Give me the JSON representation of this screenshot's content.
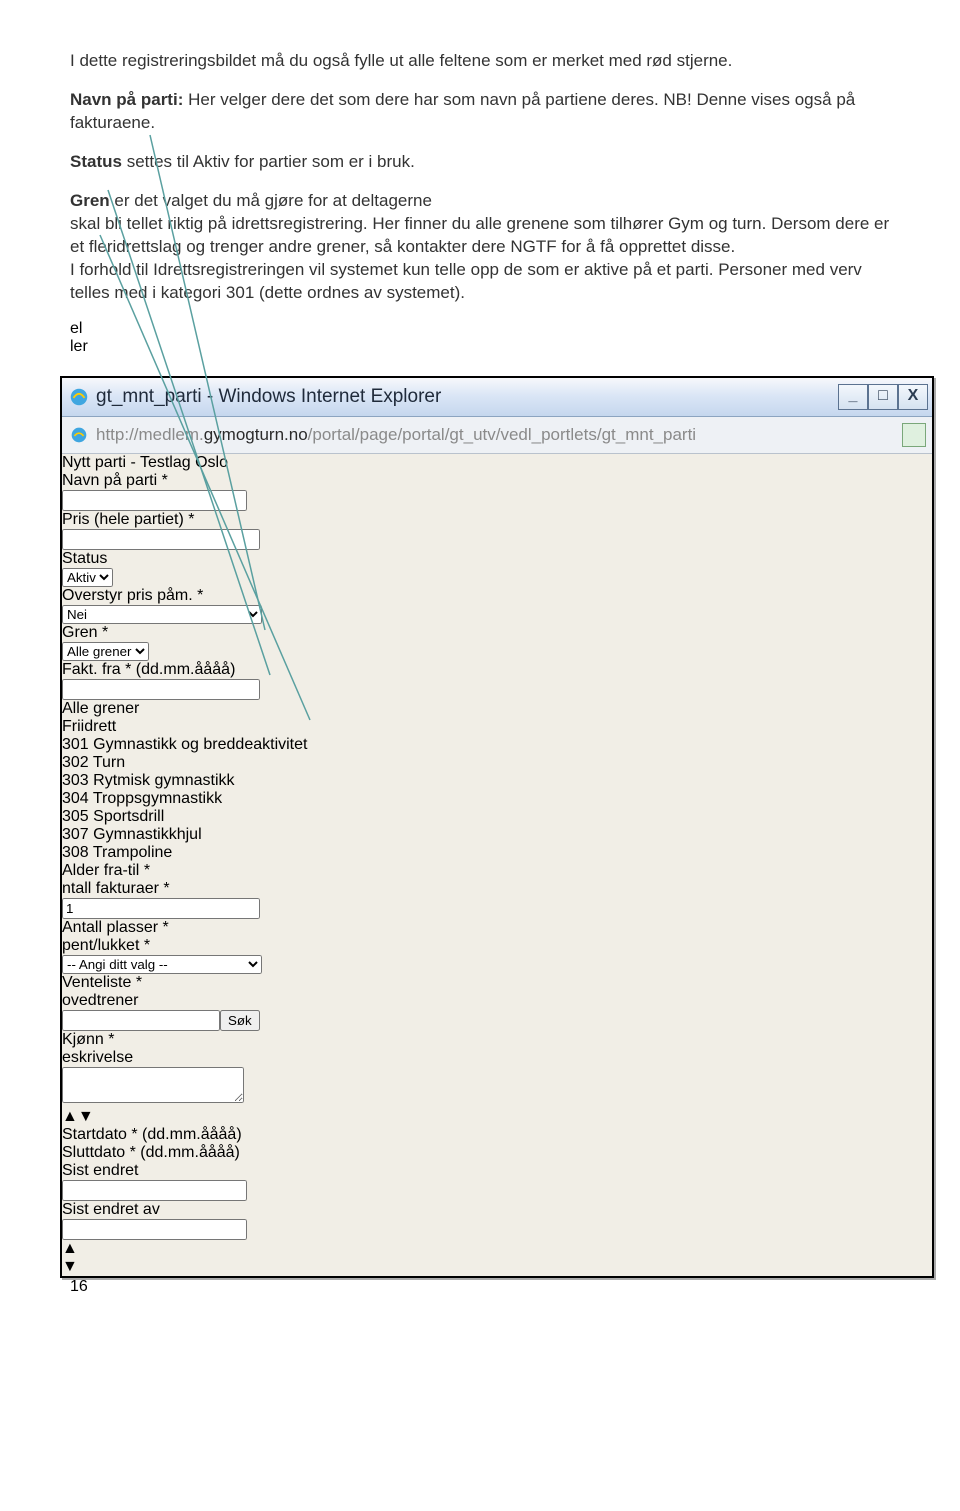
{
  "doc": {
    "p1": "I dette registreringsbildet må du også fylle ut alle feltene som er merket med rød stjerne.",
    "p2a": "Navn på parti:",
    "p2b": " Her velger dere det som dere har som navn på partiene deres. NB! Denne vises også på fakturaene.",
    "p3a": "Status",
    "p3b": " settes til Aktiv for partier som er i bruk.",
    "p4a": "Gren",
    "p4b": " er det valget du må gjøre for at deltagerne",
    "p4c": "skal bli tellet riktig på idrettsregistrering. Her finner du alle grenene som tilhører Gym og turn. Dersom dere er et fleridrettslag og trenger andre grener, så kontakter dere NGTF for å få opprettet disse.",
    "p4d": "I forhold til Idrettsregistreringen vil systemet kun telle opp de som er aktive på et parti. Personer med verv telles med i kategori 301 (dette ordnes av systemet)."
  },
  "peek": {
    "a": "el",
    "b": "ler"
  },
  "window": {
    "title": "gt_mnt_parti - Windows Internet Explorer",
    "url_gray1": "http://medlem.",
    "url_dark": "gymogturn.no",
    "url_gray2": "/portal/page/portal/gt_utv/vedl_portlets/gt_mnt_parti"
  },
  "form": {
    "title": "Nytt parti - Testlag Oslo",
    "labels": {
      "navn": "Navn på parti",
      "status": "Status",
      "gren": "Gren",
      "alder": "Alder fra-til",
      "plasser": "Antall plasser",
      "venteliste": "Venteliste",
      "kjonn": "Kjønn",
      "startdato": "Startdato * (dd.mm.åååå)",
      "sluttdato": "Sluttdato * (dd.mm.åååå)",
      "sistendret": "Sist endret",
      "sistendretav": "Sist endret av",
      "pris": "Pris (hele partiet)",
      "overstyr": "Overstyr pris påm.",
      "faktfra": "Fakt. fra * (dd.mm.åååå)",
      "antfakt": "ntall fakturaer",
      "apent": "pent/lukket",
      "hovedtrener": "ovedtrener",
      "beskrivelse": "eskrivelse"
    },
    "values": {
      "status": "Aktiv",
      "gren": "Alle grener",
      "overstyr": "Nei",
      "antfakt": "1",
      "apent": "-- Angi ditt valg --",
      "sok": "Søk"
    },
    "gren_options": [
      "Alle grener",
      "Friidrett",
      "301 Gymnastikk og breddeaktivitet",
      "302 Turn",
      "303 Rytmisk gymnastikk",
      "304 Troppsgymnastikk",
      "305 Sportsdrill",
      "307 Gymnastikkhjul",
      "308 Trampoline"
    ]
  },
  "pagenum": "16"
}
